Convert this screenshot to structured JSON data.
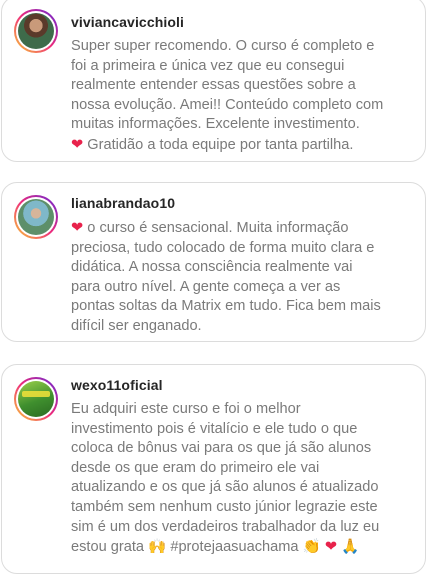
{
  "reviews": [
    {
      "username": "viviancavicchioli",
      "lines": [
        "Super super recomendo. O curso é completo e",
        "foi a primeira e única vez que eu consegui",
        "realmente entender essas questões sobre a",
        "nossa evolução. Amei!! Conteúdo completo com",
        "muitas informações. Excelente investimento.",
        "Gratidão a toda equipe por tanta partilha."
      ],
      "emoji_before_last": "❤"
    },
    {
      "username": "lianabrandao10",
      "lines": [
        "o curso é sensacional. Muita informação",
        "preciosa, tudo colocado de forma muito clara e",
        "didática. A nossa consciência realmente vai",
        "para outro nível. A gente começa a ver as",
        "pontas soltas da Matrix em tudo. Fica bem mais",
        "difícil ser enganado."
      ],
      "emoji_before_first": "❤"
    },
    {
      "username": "wexo11oficial",
      "lines": [
        "Eu adquiri este curso e foi o melhor",
        "investimento pois é vitalício e ele tudo o que",
        "coloca de bônus vai para os que já são alunos",
        "desde os que eram do primeiro ele vai",
        "atualizando e os que já são alunos é atualizado",
        "também sem nenhum custo júnior legrazie este",
        "sim é um dos verdadeiros trabalhador da luz eu",
        "estou grata",
        "#protejaasuachama"
      ],
      "emojis": [
        "🙌",
        "👏",
        "❤",
        "🙏"
      ]
    }
  ],
  "colors": {
    "heart": "#e8224b",
    "text": "#7a7a7a",
    "username": "#262626",
    "border": "#dcdcdc"
  }
}
